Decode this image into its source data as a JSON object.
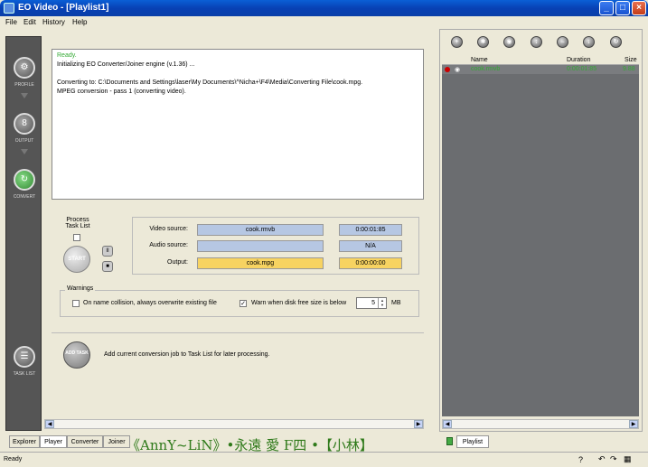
{
  "window": {
    "title": "EO Video - [Playlist1]",
    "minimize": "_",
    "maximize": "□",
    "close": "×"
  },
  "menu": [
    {
      "label": "File"
    },
    {
      "label": "Edit"
    },
    {
      "label": "History"
    },
    {
      "label": "Help"
    }
  ],
  "nav": {
    "profile": "PROFILE",
    "output": "OUTPUT",
    "convert": "CONVERT",
    "task_list": "TASK LIST"
  },
  "log": {
    "status": "Ready.",
    "lines": [
      "Initializing EO Converter/Joiner engine (v.1.36) ...",
      "",
      "Converting to: C:\\Documents and Settings\\laser\\My Documents\\^Nicha+\\F4\\Media\\Converting File\\cook.mpg.",
      "      MPEG conversion - pass 1 (converting video)."
    ]
  },
  "process": {
    "label": "Process Task List",
    "start": "START",
    "pause": "II",
    "stop": "■",
    "video_source_label": "Video source:",
    "video_source": "cook.rmvb",
    "video_duration": "0:00:01:85",
    "audio_source_label": "Audio source:",
    "audio_source": "",
    "audio_duration": "N/A",
    "output_label": "Output:",
    "output": "cook.mpg",
    "output_duration": "0:00:00:00"
  },
  "warnings": {
    "title": "Warnings",
    "collision": "On name collision, always overwrite existing file",
    "collision_checked": false,
    "disk": "Warn when disk free size is below",
    "disk_checked": true,
    "disk_value": "5",
    "unit": "MB"
  },
  "addtask": {
    "button": "ADD TASK",
    "desc": "Add current conversion job to Task List for later processing."
  },
  "tabs": [
    "Explorer",
    "Player",
    "Converter",
    "Joiner"
  ],
  "playlist": {
    "tab": "Playlist",
    "columns": [
      "Name",
      "Duration",
      "Size"
    ],
    "row": {
      "name": "cook.rmvb",
      "duration": "0:00:01:85",
      "size": "9.88"
    }
  },
  "status": {
    "text": "Ready"
  },
  "watermark": "《AnnY~LiN》•永遠 愛 F四 •【小林】",
  "colors": {
    "accent_blue": "#b6c7e3",
    "accent_gold": "#f7d361",
    "log_green": "#33aa33",
    "playlist_bg": "#6b6d70"
  }
}
